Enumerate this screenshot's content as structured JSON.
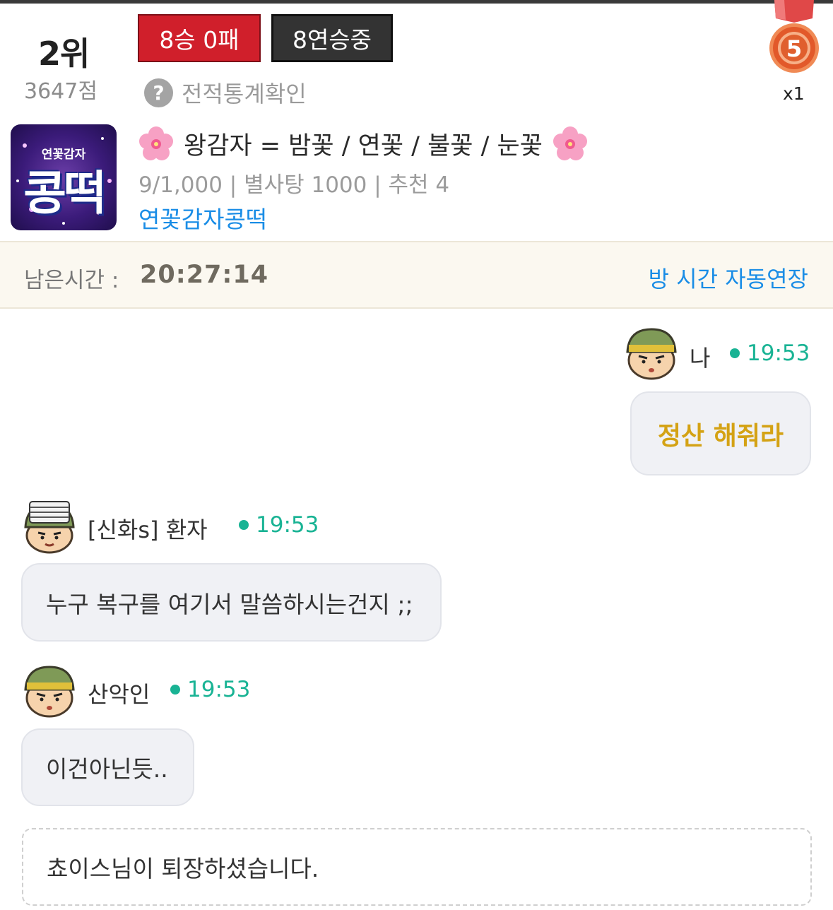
{
  "header": {
    "rank": "2위",
    "points": "3647점",
    "record_badge": "8승 0패",
    "streak_badge": "8연승중",
    "stats_link": "전적통계확인",
    "medal_number": "5",
    "medal_multiplier": "x1"
  },
  "room": {
    "thumb_sub": "연꽃감자",
    "thumb_main": "콩떡",
    "title": "왕감자 = 밤꽃 / 연꽃 / 불꽃 / 눈꽃",
    "meta": "9/1,000 | 별사탕 1000 | 추천 4",
    "owner": "연꽃감자콩떡"
  },
  "timer": {
    "label": "남은시간 :",
    "value": "20:27:14",
    "extend_label": "방 시간 자동연장"
  },
  "messages": [
    {
      "nick": "나",
      "time": "19:53",
      "text": "정산 해줘라"
    },
    {
      "nick": "[신화s] 환자",
      "time": "19:53",
      "text": "누구 복구를 여기서 말씀하시는건지 ;;"
    },
    {
      "nick": "산악인",
      "time": "19:53",
      "text": "이건아닌듯.."
    }
  ],
  "system_message": "쵸이스님이 퇴장하셨습니다.",
  "colors": {
    "record_red": "#d01f2b",
    "streak_dark": "#333333",
    "link_blue": "#1a8de6",
    "time_green": "#19b394",
    "my_message_gold": "#d4a214"
  }
}
